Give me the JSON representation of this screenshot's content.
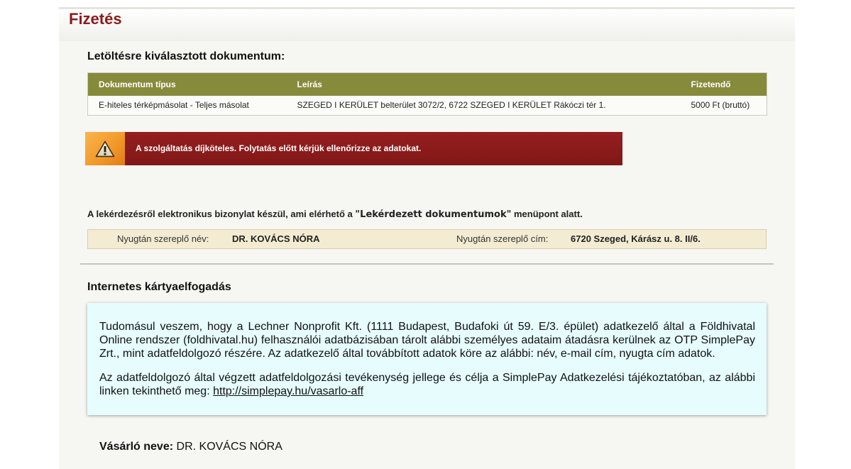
{
  "colors": {
    "accent": "#8b1c1c",
    "table_header": "#868a3b",
    "warning": "#8c1b1b",
    "warning_icon_bg": "#f29a2b",
    "receipt_box": "#f3ecd2",
    "consent_box": "#e6fcfd"
  },
  "page": {
    "title": "Fizetés"
  },
  "document_section": {
    "heading": "Letöltésre kiválasztott dokumentum:",
    "table": {
      "columns": [
        "Dokumentum típus",
        "Leírás",
        "Fizetendő"
      ],
      "rows": [
        [
          "E-hiteles térképmásolat - Teljes másolat",
          "SZEGED I KERÜLET belterület 3072/2, 6722 SZEGED I KERÜLET Rákóczi tér 1.",
          "5000 Ft (bruttó)"
        ]
      ]
    }
  },
  "warning": {
    "icon": "warning-triangle-icon",
    "text": "A szolgáltatás díjköteles. Folytatás előtt kérjük ellenőrizze az adatokat."
  },
  "receipt_notice": {
    "prefix": "A lekérdezésről elektronikus bizonylat készül, ami elérhető a ",
    "highlight": "\"Lekérdezett dokumentumok\"",
    "suffix": " menüpont alatt."
  },
  "receipt": {
    "name_label": "Nyugtán szereplő név:",
    "name_value": "DR. KOVÁCS NÓRA",
    "address_label": "Nyugtán szereplő cím:",
    "address_value": "6720 Szeged, Kárász u. 8. II/6."
  },
  "card_section": {
    "heading": "Internetes kártyaelfogadás",
    "paragraph_1": "Tudomásul veszem, hogy a Lechner Nonprofit Kft. (1111 Budapest, Budafoki út 59. E/3. épület) adatkezelő által a Földhivatal Online rendszer (foldhivatal.hu) felhasználói adatbázisában tárolt alábbi személyes adataim átadásra kerülnek az OTP SimplePay Zrt., mint adatfeldolgozó részére. Az adatkezelő által továbbított adatok köre az alábbi: név, e-mail cím, nyugta cím adatok.",
    "paragraph_2": "Az adatfeldolgozó által végzett adatfeldolgozási tevékenység jellege és célja a SimplePay Adatkezelési tájékoztatóban, az alábbi linken tekinthető meg: ",
    "link_text": "http://simplepay.hu/vasarlo-aff"
  },
  "buyer": {
    "name_label": "Vásárló neve:",
    "name_value": "DR. KOVÁCS NÓRA"
  }
}
